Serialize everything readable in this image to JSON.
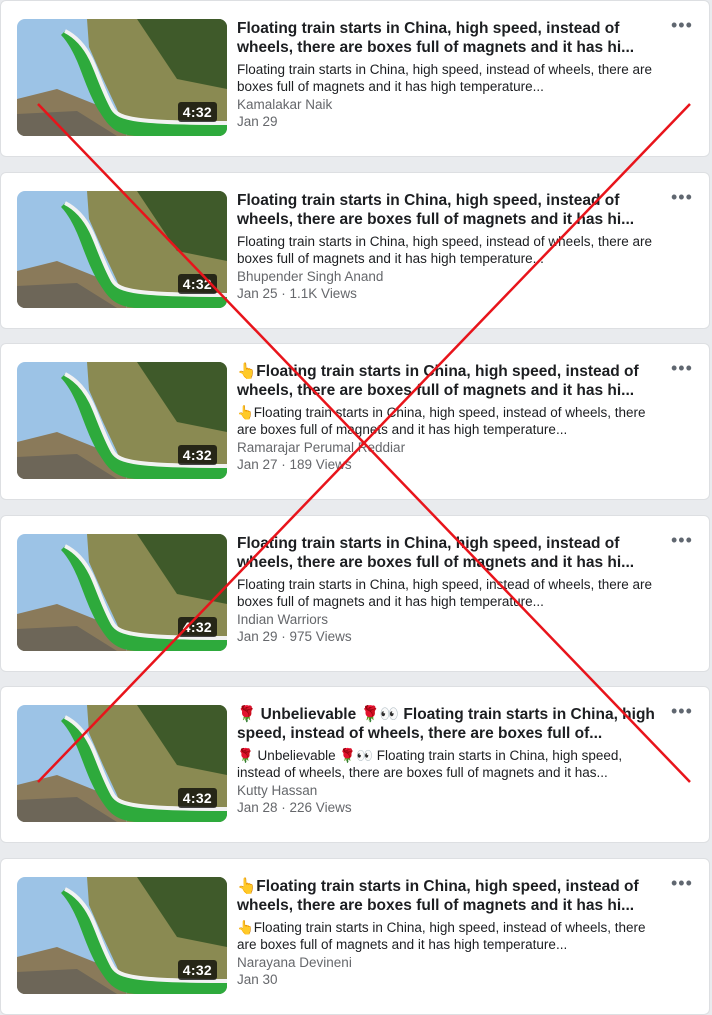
{
  "videos": [
    {
      "title": "Floating train starts in China, high speed, instead of wheels, there are boxes full of magnets and it has hi...",
      "description": "Floating train starts in China, high speed, instead of wheels, there are boxes full of magnets and it has high temperature...",
      "author": "Kamalakar Naik",
      "meta": "Jan 29",
      "duration": "4:32"
    },
    {
      "title": "Floating train starts in China, high speed, instead of wheels, there are boxes full of magnets and it has hi...",
      "description": "Floating train starts in China, high speed, instead of wheels, there are boxes full of magnets and it has high temperature...",
      "author": "Bhupender Singh Anand",
      "meta": "Jan 25 · 1.1K Views",
      "duration": "4:32"
    },
    {
      "title": "👆Floating train starts in China, high speed, instead of wheels, there are boxes full of magnets and it has hi...",
      "description": "👆Floating train starts in China, high speed, instead of wheels, there are boxes full of magnets and it has high temperature...",
      "author": "Ramarajar Perumal Reddiar",
      "meta": "Jan 27 · 189 Views",
      "duration": "4:32"
    },
    {
      "title": "Floating train starts in China, high speed, instead of wheels, there are boxes full of magnets and it has hi...",
      "description": "Floating train starts in China, high speed, instead of wheels, there are boxes full of magnets and it has high temperature...",
      "author": "Indian Warriors",
      "meta": "Jan 29 · 975 Views",
      "duration": "4:32"
    },
    {
      "title": "🌹 Unbelievable 🌹👀 Floating train starts in China, high speed, instead of wheels, there are boxes full of...",
      "description": "🌹 Unbelievable 🌹👀 Floating train starts in China, high speed, instead of wheels, there are boxes full of magnets and it has...",
      "author": "Kutty Hassan",
      "meta": "Jan 28 · 226 Views",
      "duration": "4:32"
    },
    {
      "title": "👆Floating train starts in China, high speed, instead of wheels, there are boxes full of magnets and it has hi...",
      "description": "👆Floating train starts in China, high speed, instead of wheels, there are boxes full of magnets and it has high temperature...",
      "author": "Narayana Devineni",
      "meta": "Jan 30",
      "duration": "4:32"
    }
  ],
  "more_icon": "more-options-icon",
  "colors": {
    "train_green": "#2eaa3c",
    "cross_red": "#e8141b",
    "meta_gray": "#65676b"
  }
}
